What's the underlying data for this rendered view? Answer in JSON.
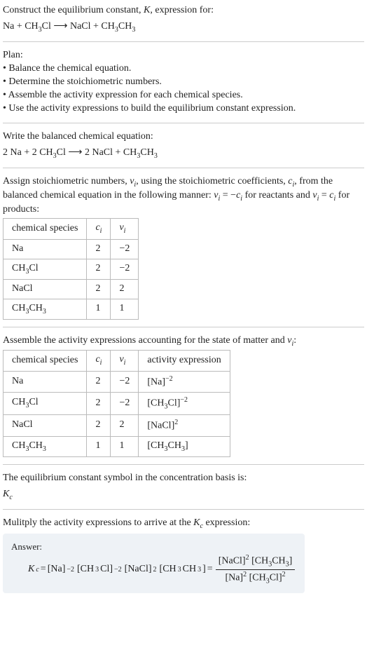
{
  "intro": {
    "line1": "Construct the equilibrium constant, ",
    "ksym": "K",
    "line1b": ", expression for:",
    "eq1_lhs": "Na + CH",
    "eq1_sub1": "3",
    "eq1_mid": "Cl  ⟶  NaCl + CH",
    "eq1_sub2": "3",
    "eq1_mid2": "CH",
    "eq1_sub3": "3"
  },
  "plan": {
    "title": "Plan:",
    "b1": "• Balance the chemical equation.",
    "b2": "• Determine the stoichiometric numbers.",
    "b3": "• Assemble the activity expression for each chemical species.",
    "b4": "• Use the activity expressions to build the equilibrium constant expression."
  },
  "balanced": {
    "title": "Write the balanced chemical equation:",
    "eq_a": "2 Na + 2 CH",
    "eq_s1": "3",
    "eq_b": "Cl  ⟶  2 NaCl + CH",
    "eq_s2": "3",
    "eq_c": "CH",
    "eq_s3": "3"
  },
  "assign": {
    "t1": "Assign stoichiometric numbers, ",
    "nu": "ν",
    "i": "i",
    "t2": ", using the stoichiometric coefficients, ",
    "c": "c",
    "t3": ", from the balanced chemical equation in the following manner: ",
    "rel1a": "ν",
    "rel1b": " = −",
    "rel1c": "c",
    "t4": " for reactants and ",
    "rel2a": "ν",
    "rel2b": " = ",
    "rel2c": "c",
    "t5": " for products:"
  },
  "table1": {
    "h1": "chemical species",
    "h2a": "c",
    "h2b": "i",
    "h3a": "ν",
    "h3b": "i",
    "rows": [
      {
        "s": "Na",
        "c": "2",
        "v": "−2"
      },
      {
        "s": "CH₃Cl",
        "s_a": "CH",
        "s_sub": "3",
        "s_b": "Cl",
        "c": "2",
        "v": "−2"
      },
      {
        "s": "NaCl",
        "c": "2",
        "v": "2"
      },
      {
        "s_a": "CH",
        "s_sub": "3",
        "s_b": "CH",
        "s_sub2": "3",
        "c": "1",
        "v": "1"
      }
    ]
  },
  "assemble": {
    "t1": "Assemble the activity expressions accounting for the state of matter and ",
    "nu": "ν",
    "i": "i",
    "t2": ":"
  },
  "table2": {
    "h1": "chemical species",
    "h2a": "c",
    "h2b": "i",
    "h3a": "ν",
    "h3b": "i",
    "h4": "activity expression",
    "rows": [
      {
        "s": "Na",
        "c": "2",
        "v": "−2",
        "ae_base": "[Na]",
        "ae_sup": "−2"
      },
      {
        "s_a": "CH",
        "s_sub": "3",
        "s_b": "Cl",
        "c": "2",
        "v": "−2",
        "ae_a": "[CH",
        "ae_sub": "3",
        "ae_b": "Cl]",
        "ae_sup": "−2"
      },
      {
        "s": "NaCl",
        "c": "2",
        "v": "2",
        "ae_base": "[NaCl]",
        "ae_sup": "2"
      },
      {
        "s_a": "CH",
        "s_sub": "3",
        "s_b": "CH",
        "s_sub2": "3",
        "c": "1",
        "v": "1",
        "ae_a": "[CH",
        "ae_sub": "3",
        "ae_b": "CH",
        "ae_sub2": "3",
        "ae_c": "]"
      }
    ]
  },
  "kc_symbol": {
    "t": "The equilibrium constant symbol in the concentration basis is:",
    "k": "K",
    "c": "c"
  },
  "multiply": {
    "t1": "Mulitply the activity expressions to arrive at the ",
    "k": "K",
    "c": "c",
    "t2": " expression:"
  },
  "answer": {
    "label": "Answer:",
    "k": "K",
    "c": "c",
    "eq": " = ",
    "p1": "[Na]",
    "p1s": "−2",
    "sp": " ",
    "p2a": "[CH",
    "p2sub": "3",
    "p2b": "Cl]",
    "p2s": "−2",
    "p3": "[NaCl]",
    "p3s": "2",
    "p4a": "[CH",
    "p4sub": "3",
    "p4b": "CH",
    "p4sub2": "3",
    "p4c": "]",
    "eq2": " = ",
    "num1": "[NaCl]",
    "num1s": "2",
    "num2a": "[CH",
    "num2sub": "3",
    "num2b": "CH",
    "num2sub2": "3",
    "num2c": "]",
    "den1": "[Na]",
    "den1s": "2",
    "den2a": "[CH",
    "den2sub": "3",
    "den2b": "Cl]",
    "den2s": "2"
  }
}
